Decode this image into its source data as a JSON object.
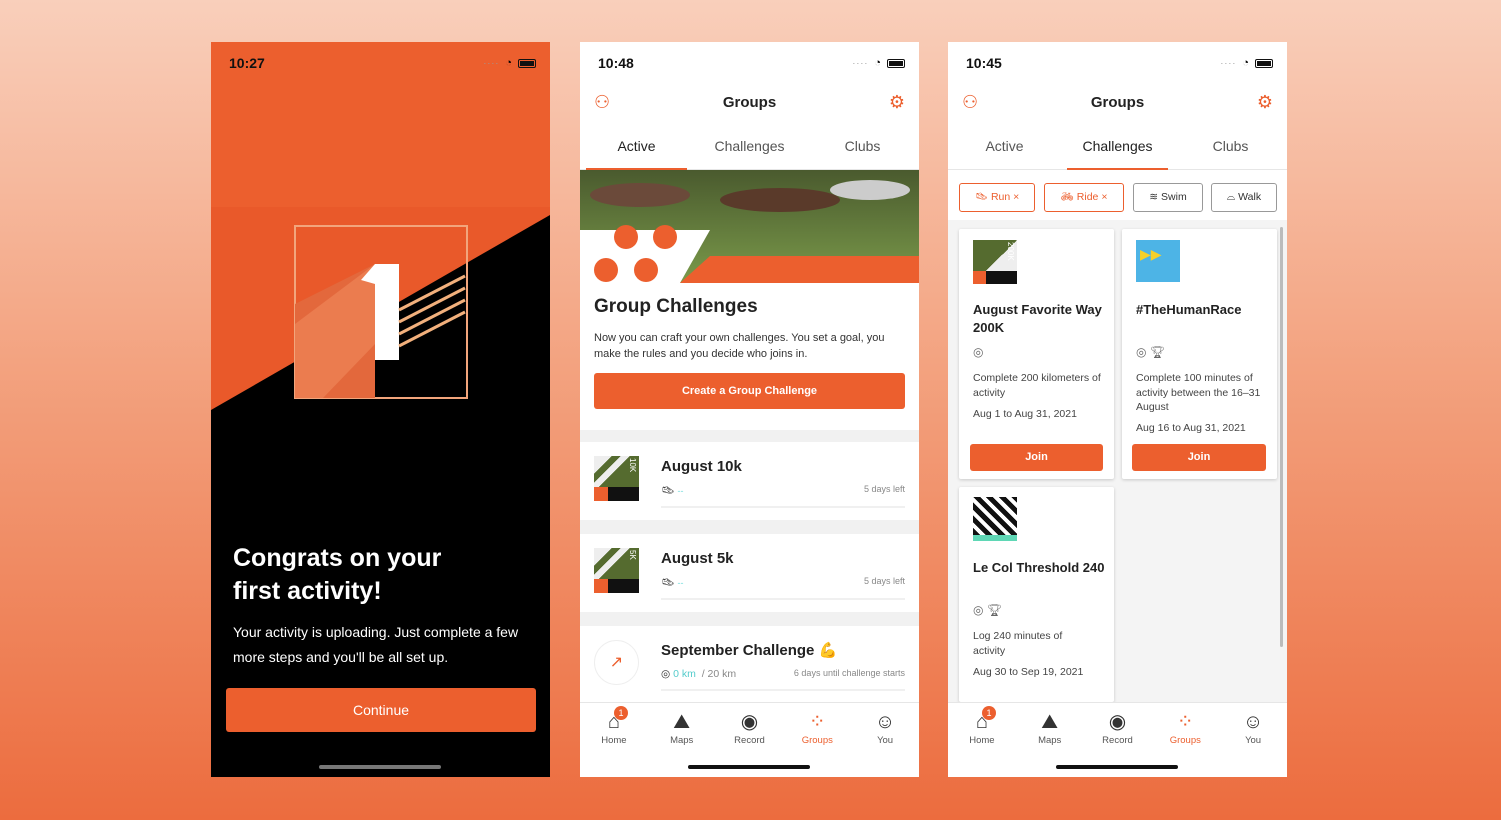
{
  "colors": {
    "accent": "#ec5f2e",
    "dark": "#111111"
  },
  "phone1": {
    "time": "10:27",
    "title": "Congrats on your first activity!",
    "body": "Your activity is uploading. Just complete a few more steps and you'll be all set up.",
    "continue": "Continue",
    "badge_number": "1"
  },
  "phone2": {
    "time": "10:48",
    "header": "Groups",
    "tabs": [
      "Active",
      "Challenges",
      "Clubs"
    ],
    "active_tab": "Active",
    "hero_title": "Group Challenges",
    "hero_body": "Now you can craft your own challenges. You set a goal, you make the rules and you decide who joins in.",
    "create_button": "Create a Group Challenge",
    "items": [
      {
        "title": "August 10k",
        "badge": "10K",
        "progress": "--",
        "status": "5 days left",
        "icon": "shoe-icon"
      },
      {
        "title": "August 5k",
        "badge": "5K",
        "progress": "--",
        "status": "5 days left",
        "icon": "shoe-icon"
      },
      {
        "title": "September Challenge 💪",
        "progress": "0 km",
        "goal": "/ 20 km",
        "status": "6 days until challenge starts",
        "icon": "multisport-icon"
      }
    ]
  },
  "phone3": {
    "time": "10:45",
    "header": "Groups",
    "tabs": [
      "Active",
      "Challenges",
      "Clubs"
    ],
    "active_tab": "Challenges",
    "filters": [
      {
        "label": "Run",
        "selected": true,
        "icon": "shoe-icon"
      },
      {
        "label": "Ride",
        "selected": true,
        "icon": "bike-icon"
      },
      {
        "label": "Swim",
        "selected": false,
        "icon": "waves-icon"
      },
      {
        "label": "Walk",
        "selected": false,
        "icon": "sneaker-icon"
      }
    ],
    "cards": [
      {
        "title": "August Favorite Way 200K",
        "badge": "200K",
        "desc": "Complete 200 kilometers of activity",
        "dates": "Aug 1 to Aug 31, 2021",
        "button": "Join"
      },
      {
        "title": "#TheHumanRace",
        "desc": "Complete 100 minutes of activity between the 16–31 August",
        "dates": "Aug 16 to Aug 31, 2021",
        "button": "Join"
      },
      {
        "title": "Le Col Threshold 240",
        "desc": "Log 240 minutes of activity",
        "dates": "Aug 30 to Sep 19, 2021"
      }
    ]
  },
  "nav": {
    "items": [
      "Home",
      "Maps",
      "Record",
      "Groups",
      "You"
    ],
    "active": "Groups",
    "home_badge": "1"
  }
}
